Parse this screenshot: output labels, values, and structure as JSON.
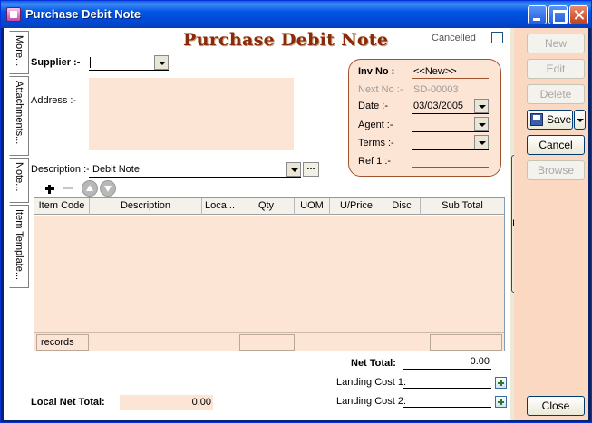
{
  "window": {
    "title": "Purchase Debit Note"
  },
  "side_tabs": [
    "More...",
    "Attachments...",
    "Note...",
    "Item Template..."
  ],
  "form": {
    "heading": "Purchase Debit Note",
    "cancelled_label": "Cancelled",
    "supplier_label": "Supplier :-",
    "supplier_value": "",
    "address_label": "Address :-",
    "description_label": "Description :-",
    "description_value": "Debit Note",
    "description_button": "..."
  },
  "info_panel": {
    "inv_no_label": "Inv No :",
    "inv_no_value": "<<New>>",
    "next_no_label": "Next No :-",
    "next_no_value": "SD-00003",
    "date_label": "Date :-",
    "date_value": "03/03/2005",
    "agent_label": "Agent :-",
    "agent_value": "",
    "terms_label": "Terms :-",
    "terms_value": "",
    "ref1_label": "Ref 1 :-",
    "ref1_value": ""
  },
  "grid": {
    "columns": [
      "Item Code",
      "Description",
      "Loca...",
      "Qty",
      "UOM",
      "U/Price",
      "Disc",
      "Sub Total"
    ],
    "footer_records_label": "records"
  },
  "totals": {
    "net_total_label": "Net Total:",
    "net_total_value": "0.00",
    "landing_cost1_label": "Landing Cost 1:",
    "landing_cost2_label": "Landing Cost 2:",
    "local_net_total_label": "Local Net Total:",
    "local_net_total_value": "0.00"
  },
  "actions": {
    "new": "New",
    "edit": "Edit",
    "delete": "Delete",
    "save": "Save",
    "cancel": "Cancel",
    "browse": "Browse",
    "close": "Close"
  }
}
